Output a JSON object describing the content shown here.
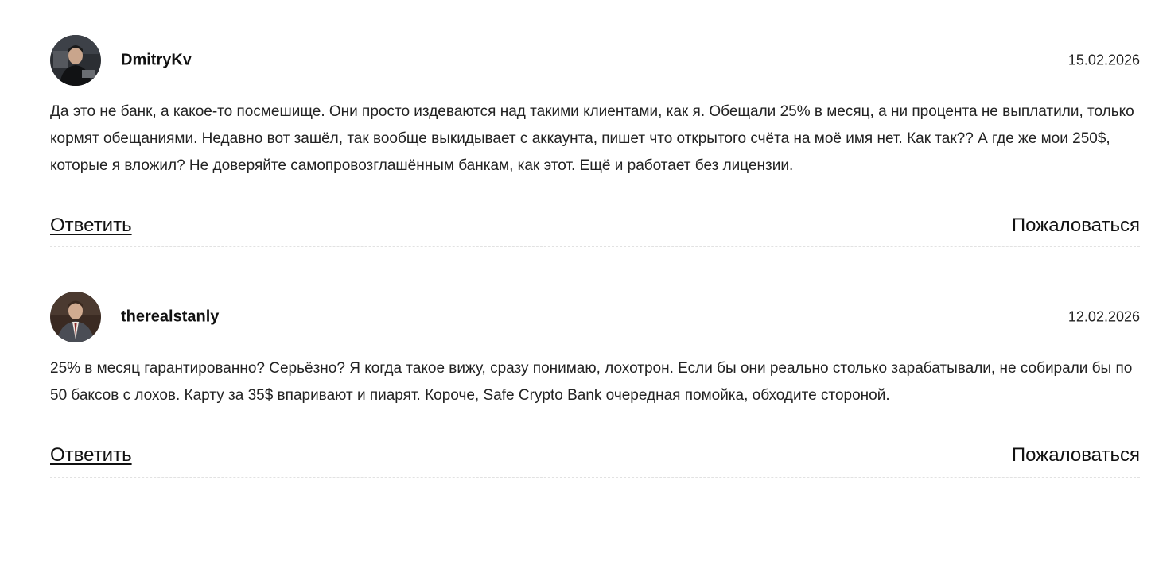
{
  "comments": [
    {
      "author": "DmitryKv",
      "date": "15.02.2026",
      "avatar_icon": "user-avatar-photo",
      "text": "Да это не банк, а какое-то посмешище. Они просто издеваются над такими клиентами, как я. Обещали 25% в месяц, а ни процента не выплатили, только кормят обещаниями. Недавно вот зашёл, так вообще выкидывает с аккаунта, пишет что открытого счёта на моё имя нет. Как так?? А где же мои 250$, которые я вложил? Не доверяйте самопровозглашённым банкам, как этот. Ещё и работает без лицензии.",
      "reply_label": "Ответить",
      "report_label": "Пожаловаться"
    },
    {
      "author": "therealstanly",
      "date": "12.02.2026",
      "avatar_icon": "user-avatar-photo",
      "text": "25% в месяц гарантированно? Серьёзно? Я когда такое вижу, сразу понимаю, лохотрон. Если бы они реально столько зарабатывали, не собирали бы по 50 баксов с лохов. Карту за 35$ впаривают и пиарят. Короче, Safe Crypto Bank очередная помойка, обходите стороной.",
      "reply_label": "Ответить",
      "report_label": "Пожаловаться"
    }
  ],
  "colors": {
    "text": "#222222",
    "divider": "#e2e2e2",
    "background": "#ffffff"
  }
}
